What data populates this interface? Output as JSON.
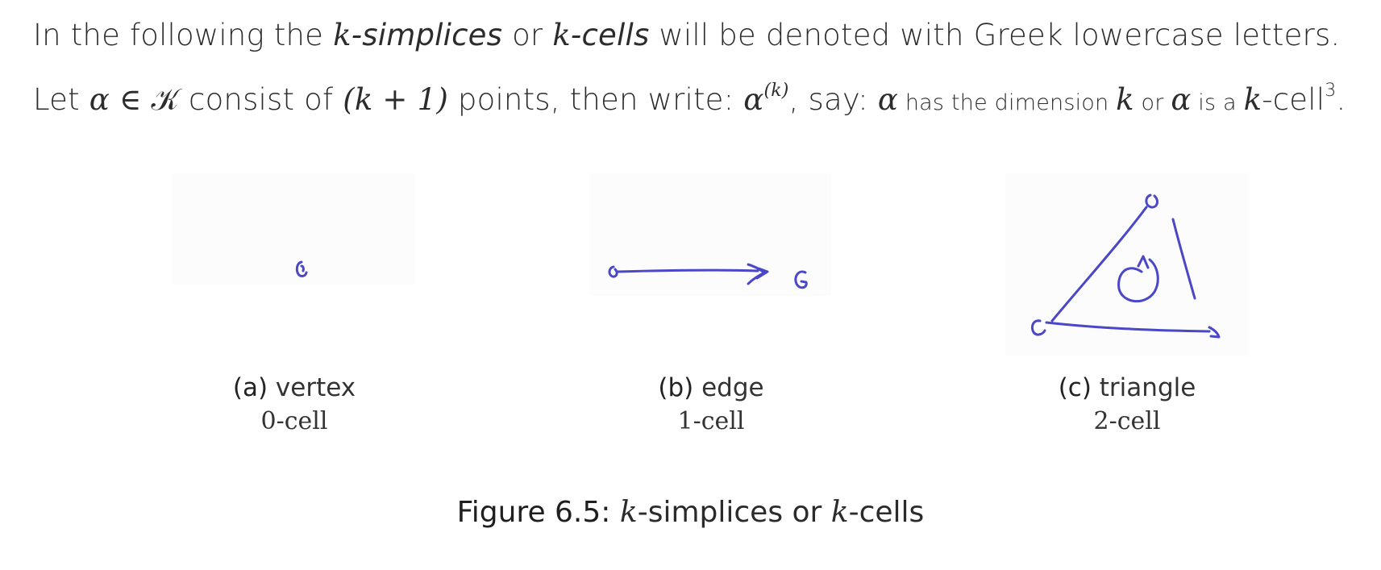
{
  "text": {
    "line1": {
      "p1": "In the following the ",
      "k1": "k",
      "simplices": "-simplices",
      "or": " or ",
      "k2": "k",
      "cells": "-cells",
      "p2": " will be denoted with Greek lowercase letters."
    },
    "line2": {
      "let": "Let ",
      "alpha": "α",
      "in_K": " ∈ 𝒦",
      "consist": " consist of ",
      "k_plus_1": "(k + 1)",
      "points": " points, then write: ",
      "alpha_k": "α",
      "sup_k": "(k)",
      "say": ", say: ",
      "alpha2": "α",
      "has_dim": " has the dimension ",
      "k": "k",
      "or": " or ",
      "alpha3": "α",
      "is_a": " is a ",
      "kcell_k": "k",
      "kcell": "-cell",
      "footnote": "3",
      "period": "."
    }
  },
  "subfigures": [
    {
      "label": "(a)",
      "name": "vertex",
      "cell": "0-cell"
    },
    {
      "label": "(b)",
      "name": "edge",
      "cell": "1-cell"
    },
    {
      "label": "(c)",
      "name": "triangle",
      "cell": "2-cell"
    }
  ],
  "figure_caption": {
    "prefix": "Figure 6.5:",
    "k1": "k",
    "middle": "-simplices or ",
    "k2": "k",
    "suffix": "-cells"
  },
  "colors": {
    "ink": "#4a47c8",
    "text": "#2c2c2c"
  }
}
